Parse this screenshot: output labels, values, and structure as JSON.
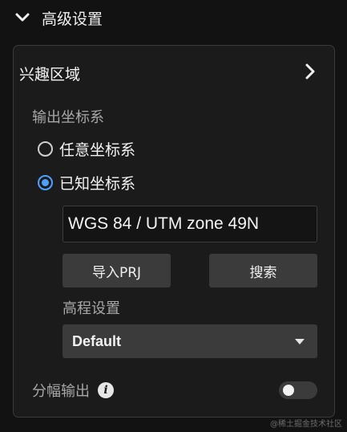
{
  "header": {
    "title": "高级设置"
  },
  "roi": {
    "label": "兴趣区域"
  },
  "output_crs": {
    "label": "输出坐标系",
    "options": [
      {
        "label": "任意坐标系",
        "checked": false
      },
      {
        "label": "已知坐标系",
        "checked": true
      }
    ],
    "crs_value": "WGS 84 / UTM zone 49N",
    "import_label": "导入PRJ",
    "search_label": "搜索"
  },
  "elevation": {
    "label": "高程设置",
    "selected": "Default"
  },
  "split_output": {
    "label": "分幅输出",
    "enabled": false
  },
  "watermark": "@稀土掘金技术社区",
  "colors": {
    "accent": "#4ea0ff",
    "background": "#121212",
    "panel": "#1b1b1b",
    "control": "#3b3b3b"
  }
}
